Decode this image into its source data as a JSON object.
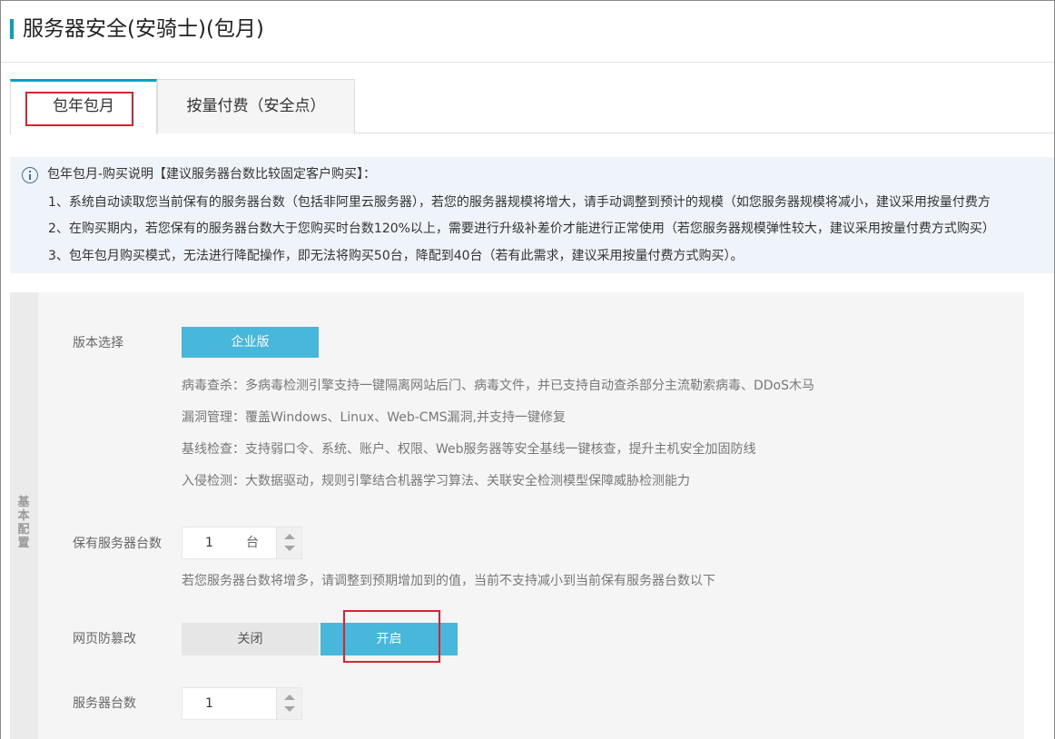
{
  "header": {
    "title": "服务器安全(安骑士)(包月)"
  },
  "tabs": [
    {
      "label": "包年包月",
      "active": true
    },
    {
      "label": "按量付费（安全点）",
      "active": false
    }
  ],
  "notice": {
    "icon": "info-icon",
    "title": "包年包月-购买说明【建议服务器台数比较固定客户购买】：",
    "lines": [
      "1、系统自动读取您当前保有的服务器台数（包括非阿里云服务器），若您的服务器规模将增大，请手动调整到预计的规模（如您服务器规模将减小，建议采用按量付费方",
      "2、在购买期内，若您保有的服务器台数大于您购买时台数120%以上，需要进行升级补差价才能进行正常使用（若您服务器规模弹性较大，建议采用按量付费方式购买）",
      "3、包年包月购买模式，无法进行降配操作，即无法将购买50台，降配到40台（若有此需求，建议采用按量付费方式购买）。"
    ]
  },
  "config": {
    "side_label": "基本配置",
    "edition": {
      "label": "版本选择",
      "selected": "企业版",
      "features": [
        "病毒查杀：多病毒检测引擎支持一键隔离网站后门、病毒文件，并已支持自动查杀部分主流勒索病毒、DDoS木马",
        "漏洞管理：覆盖Windows、Linux、Web-CMS漏洞,并支持一键修复",
        "基线检查：支持弱口令、系统、账户、权限、Web服务器等安全基线一键核查，提升主机安全加固防线",
        "入侵检测：大数据驱动，规则引擎结合机器学习算法、关联安全检测模型保障威胁检测能力"
      ]
    },
    "servers_held": {
      "label": "保有服务器台数",
      "value": "1",
      "unit": "台",
      "hint": "若您服务器台数将增多，请调整到预期增加到的值，当前不支持减小到当前保有服务器台数以下"
    },
    "tamper": {
      "label": "网页防篡改",
      "off_label": "关闭",
      "on_label": "开启",
      "selected": "开启"
    },
    "server_count": {
      "label": "服务器台数",
      "value": "1"
    }
  },
  "colors": {
    "accent": "#00a2ca",
    "button": "#47b7db",
    "highlight_box": "#d9232d"
  }
}
